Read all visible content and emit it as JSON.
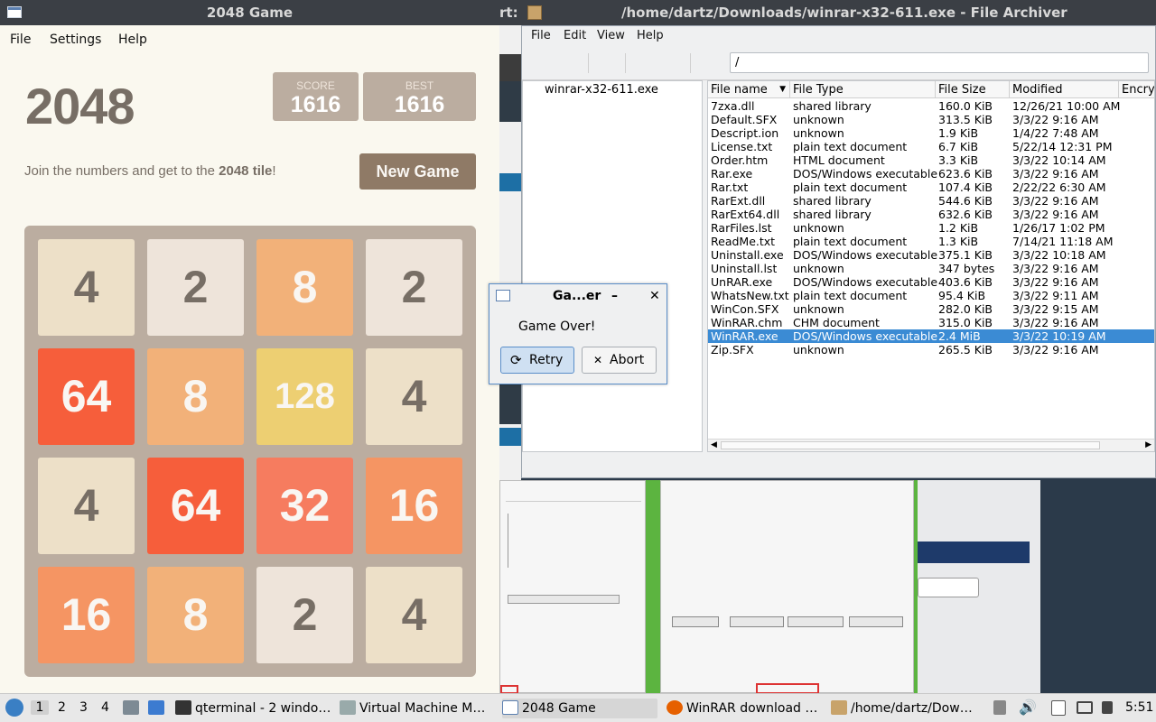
{
  "game_window": {
    "title": "2048 Game",
    "menu": [
      "File",
      "Settings",
      "Help"
    ],
    "heading": "2048",
    "score": {
      "label": "SCORE",
      "value": "1616"
    },
    "best": {
      "label": "BEST",
      "value": "1616"
    },
    "intro_prefix": "Join the numbers and get to the ",
    "intro_bold": "2048 tile",
    "intro_suffix": "!",
    "new_game_label": "New Game",
    "tiles": [
      [
        "4",
        "2",
        "8",
        "2"
      ],
      [
        "64",
        "8",
        "128",
        "4"
      ],
      [
        "4",
        "64",
        "32",
        "16"
      ],
      [
        "16",
        "8",
        "2",
        "4"
      ]
    ],
    "tile_colors": {
      "2": {
        "bg": "#eee4da",
        "fg": "#776e65"
      },
      "4": {
        "bg": "#ede0c8",
        "fg": "#776e65"
      },
      "8": {
        "bg": "#f2b179",
        "fg": "#f9f6f2"
      },
      "16": {
        "bg": "#f59563",
        "fg": "#f9f6f2"
      },
      "32": {
        "bg": "#f67c5f",
        "fg": "#f9f6f2"
      },
      "64": {
        "bg": "#f65e3b",
        "fg": "#f9f6f2"
      },
      "128": {
        "bg": "#edcf72",
        "fg": "#f9f6f2"
      }
    }
  },
  "archiver_window": {
    "title_partial": "rt:",
    "title": "/home/dartz/Downloads/winrar-x32-611.exe - File Archiver",
    "menu": [
      "File",
      "Edit",
      "View",
      "Help"
    ],
    "path": "/",
    "tree_item": "winrar-x32-611.exe",
    "columns": [
      "File name",
      "File Type",
      "File Size",
      "Modified",
      "Encryp"
    ],
    "files": [
      [
        "7zxa.dll",
        "shared library",
        "160.0 KiB",
        "12/26/21 10:00 AM"
      ],
      [
        "Default.SFX",
        "unknown",
        "313.5 KiB",
        "3/3/22 9:16 AM"
      ],
      [
        "Descript.ion",
        "unknown",
        "1.9 KiB",
        "1/4/22 7:48 AM"
      ],
      [
        "License.txt",
        "plain text document",
        "6.7 KiB",
        "5/22/14 12:31 PM"
      ],
      [
        "Order.htm",
        "HTML document",
        "3.3 KiB",
        "3/3/22 10:14 AM"
      ],
      [
        "Rar.exe",
        "DOS/Windows executable",
        "623.6 KiB",
        "3/3/22 9:16 AM"
      ],
      [
        "Rar.txt",
        "plain text document",
        "107.4 KiB",
        "2/22/22 6:30 AM"
      ],
      [
        "RarExt.dll",
        "shared library",
        "544.6 KiB",
        "3/3/22 9:16 AM"
      ],
      [
        "RarExt64.dll",
        "shared library",
        "632.6 KiB",
        "3/3/22 9:16 AM"
      ],
      [
        "RarFiles.lst",
        "unknown",
        "1.2 KiB",
        "1/26/17 1:02 PM"
      ],
      [
        "ReadMe.txt",
        "plain text document",
        "1.3 KiB",
        "7/14/21 11:18 AM"
      ],
      [
        "Uninstall.exe",
        "DOS/Windows executable",
        "375.1 KiB",
        "3/3/22 10:18 AM"
      ],
      [
        "Uninstall.lst",
        "unknown",
        "347 bytes",
        "3/3/22 9:16 AM"
      ],
      [
        "UnRAR.exe",
        "DOS/Windows executable",
        "403.6 KiB",
        "3/3/22 9:16 AM"
      ],
      [
        "WhatsNew.txt",
        "plain text document",
        "95.4 KiB",
        "3/3/22 9:11 AM"
      ],
      [
        "WinCon.SFX",
        "unknown",
        "282.0 KiB",
        "3/3/22 9:15 AM"
      ],
      [
        "WinRAR.chm",
        "CHM document",
        "315.0 KiB",
        "3/3/22 9:16 AM"
      ],
      [
        "WinRAR.exe",
        "DOS/Windows executable",
        "2.4 MiB",
        "3/3/22 10:19 AM"
      ],
      [
        "Zip.SFX",
        "unknown",
        "265.5 KiB",
        "3/3/22 9:16 AM"
      ]
    ],
    "selected_index": 17
  },
  "dialog": {
    "title": "Ga...er",
    "message": "Game Over!",
    "retry_label": "Retry",
    "abort_label": "Abort",
    "minimize": "–",
    "close": "✕"
  },
  "taskbar": {
    "workspaces": [
      "1",
      "2",
      "3",
      "4"
    ],
    "tasks": [
      "qterminal - 2 windo…",
      "Virtual Machine M…",
      "2048 Game",
      "WinRAR download …",
      "/home/dartz/Dow…"
    ],
    "clock": "5:51"
  }
}
